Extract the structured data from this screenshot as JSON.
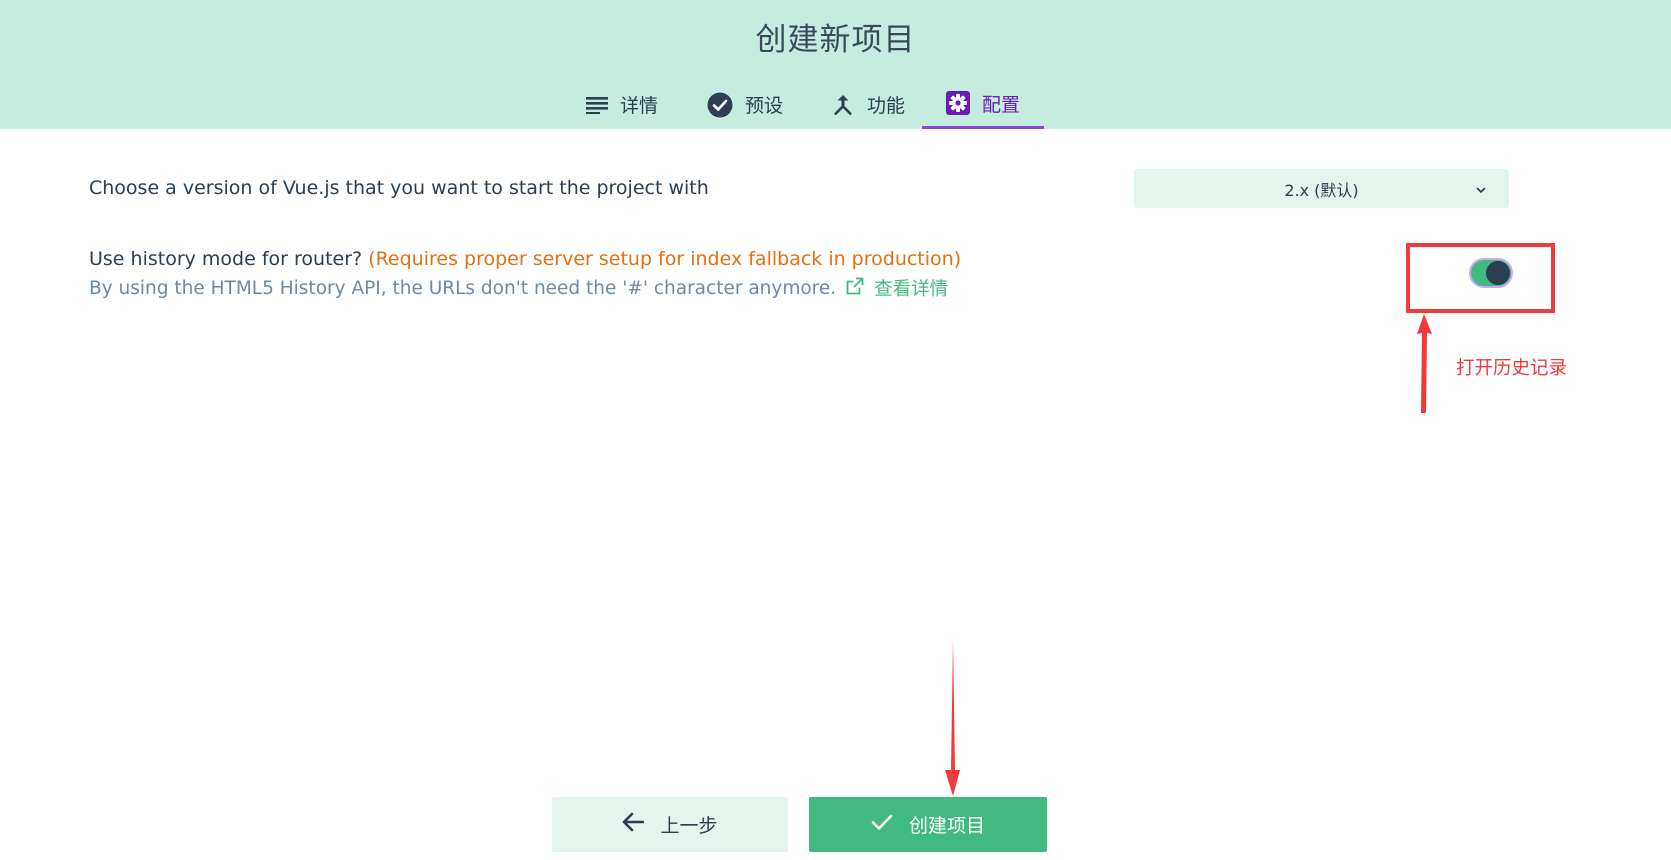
{
  "header": {
    "title": "创建新项目",
    "background": "#c6ebdf"
  },
  "tabs": [
    {
      "label": "详情",
      "icon": "list-icon",
      "active": false
    },
    {
      "label": "预设",
      "icon": "check-circle-icon",
      "active": false
    },
    {
      "label": "功能",
      "icon": "merge-type-icon",
      "active": false
    },
    {
      "label": "配置",
      "icon": "settings-icon",
      "active": true
    }
  ],
  "config": {
    "vue_version": {
      "prompt": "Choose a version of Vue.js that you want to start the project with",
      "selected": "2.x (默认)"
    },
    "history_mode": {
      "prompt": "Use history mode for router?",
      "warning": "(Requires proper server setup for index fallback in production)",
      "description": "By using the HTML5 History API, the URLs don't need the '#' character anymore.",
      "link_label": "查看详情",
      "enabled": true
    }
  },
  "annotation": {
    "text": "打开历史记录",
    "color": "#f23a3a"
  },
  "footer": {
    "prev_label": "上一步",
    "create_label": "创建项目"
  },
  "colors": {
    "accent": "#42b983",
    "active_tab": "#6a1bb5",
    "warning": "#e6700f",
    "annotation": "#f23a3a"
  }
}
